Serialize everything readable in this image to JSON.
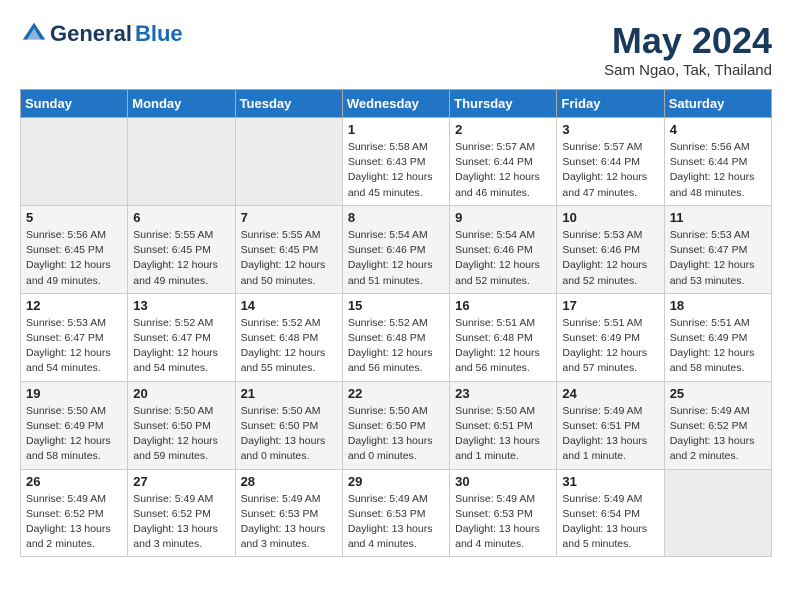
{
  "header": {
    "logo_line1": "General",
    "logo_line2": "Blue",
    "month": "May 2024",
    "location": "Sam Ngao, Tak, Thailand"
  },
  "weekdays": [
    "Sunday",
    "Monday",
    "Tuesday",
    "Wednesday",
    "Thursday",
    "Friday",
    "Saturday"
  ],
  "weeks": [
    [
      {
        "day": "",
        "info": ""
      },
      {
        "day": "",
        "info": ""
      },
      {
        "day": "",
        "info": ""
      },
      {
        "day": "1",
        "info": "Sunrise: 5:58 AM\nSunset: 6:43 PM\nDaylight: 12 hours\nand 45 minutes."
      },
      {
        "day": "2",
        "info": "Sunrise: 5:57 AM\nSunset: 6:44 PM\nDaylight: 12 hours\nand 46 minutes."
      },
      {
        "day": "3",
        "info": "Sunrise: 5:57 AM\nSunset: 6:44 PM\nDaylight: 12 hours\nand 47 minutes."
      },
      {
        "day": "4",
        "info": "Sunrise: 5:56 AM\nSunset: 6:44 PM\nDaylight: 12 hours\nand 48 minutes."
      }
    ],
    [
      {
        "day": "5",
        "info": "Sunrise: 5:56 AM\nSunset: 6:45 PM\nDaylight: 12 hours\nand 49 minutes."
      },
      {
        "day": "6",
        "info": "Sunrise: 5:55 AM\nSunset: 6:45 PM\nDaylight: 12 hours\nand 49 minutes."
      },
      {
        "day": "7",
        "info": "Sunrise: 5:55 AM\nSunset: 6:45 PM\nDaylight: 12 hours\nand 50 minutes."
      },
      {
        "day": "8",
        "info": "Sunrise: 5:54 AM\nSunset: 6:46 PM\nDaylight: 12 hours\nand 51 minutes."
      },
      {
        "day": "9",
        "info": "Sunrise: 5:54 AM\nSunset: 6:46 PM\nDaylight: 12 hours\nand 52 minutes."
      },
      {
        "day": "10",
        "info": "Sunrise: 5:53 AM\nSunset: 6:46 PM\nDaylight: 12 hours\nand 52 minutes."
      },
      {
        "day": "11",
        "info": "Sunrise: 5:53 AM\nSunset: 6:47 PM\nDaylight: 12 hours\nand 53 minutes."
      }
    ],
    [
      {
        "day": "12",
        "info": "Sunrise: 5:53 AM\nSunset: 6:47 PM\nDaylight: 12 hours\nand 54 minutes."
      },
      {
        "day": "13",
        "info": "Sunrise: 5:52 AM\nSunset: 6:47 PM\nDaylight: 12 hours\nand 54 minutes."
      },
      {
        "day": "14",
        "info": "Sunrise: 5:52 AM\nSunset: 6:48 PM\nDaylight: 12 hours\nand 55 minutes."
      },
      {
        "day": "15",
        "info": "Sunrise: 5:52 AM\nSunset: 6:48 PM\nDaylight: 12 hours\nand 56 minutes."
      },
      {
        "day": "16",
        "info": "Sunrise: 5:51 AM\nSunset: 6:48 PM\nDaylight: 12 hours\nand 56 minutes."
      },
      {
        "day": "17",
        "info": "Sunrise: 5:51 AM\nSunset: 6:49 PM\nDaylight: 12 hours\nand 57 minutes."
      },
      {
        "day": "18",
        "info": "Sunrise: 5:51 AM\nSunset: 6:49 PM\nDaylight: 12 hours\nand 58 minutes."
      }
    ],
    [
      {
        "day": "19",
        "info": "Sunrise: 5:50 AM\nSunset: 6:49 PM\nDaylight: 12 hours\nand 58 minutes."
      },
      {
        "day": "20",
        "info": "Sunrise: 5:50 AM\nSunset: 6:50 PM\nDaylight: 12 hours\nand 59 minutes."
      },
      {
        "day": "21",
        "info": "Sunrise: 5:50 AM\nSunset: 6:50 PM\nDaylight: 13 hours\nand 0 minutes."
      },
      {
        "day": "22",
        "info": "Sunrise: 5:50 AM\nSunset: 6:50 PM\nDaylight: 13 hours\nand 0 minutes."
      },
      {
        "day": "23",
        "info": "Sunrise: 5:50 AM\nSunset: 6:51 PM\nDaylight: 13 hours\nand 1 minute."
      },
      {
        "day": "24",
        "info": "Sunrise: 5:49 AM\nSunset: 6:51 PM\nDaylight: 13 hours\nand 1 minute."
      },
      {
        "day": "25",
        "info": "Sunrise: 5:49 AM\nSunset: 6:52 PM\nDaylight: 13 hours\nand 2 minutes."
      }
    ],
    [
      {
        "day": "26",
        "info": "Sunrise: 5:49 AM\nSunset: 6:52 PM\nDaylight: 13 hours\nand 2 minutes."
      },
      {
        "day": "27",
        "info": "Sunrise: 5:49 AM\nSunset: 6:52 PM\nDaylight: 13 hours\nand 3 minutes."
      },
      {
        "day": "28",
        "info": "Sunrise: 5:49 AM\nSunset: 6:53 PM\nDaylight: 13 hours\nand 3 minutes."
      },
      {
        "day": "29",
        "info": "Sunrise: 5:49 AM\nSunset: 6:53 PM\nDaylight: 13 hours\nand 4 minutes."
      },
      {
        "day": "30",
        "info": "Sunrise: 5:49 AM\nSunset: 6:53 PM\nDaylight: 13 hours\nand 4 minutes."
      },
      {
        "day": "31",
        "info": "Sunrise: 5:49 AM\nSunset: 6:54 PM\nDaylight: 13 hours\nand 5 minutes."
      },
      {
        "day": "",
        "info": ""
      }
    ]
  ]
}
